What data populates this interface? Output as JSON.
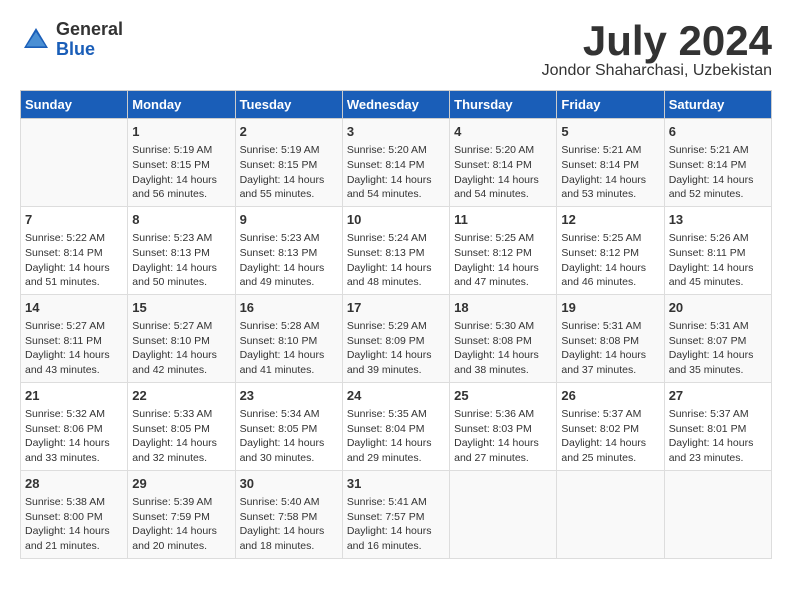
{
  "header": {
    "logo_general": "General",
    "logo_blue": "Blue",
    "month_title": "July 2024",
    "location": "Jondor Shaharchasi, Uzbekistan"
  },
  "days_of_week": [
    "Sunday",
    "Monday",
    "Tuesday",
    "Wednesday",
    "Thursday",
    "Friday",
    "Saturday"
  ],
  "weeks": [
    [
      {
        "day": "",
        "content": ""
      },
      {
        "day": "1",
        "content": "Sunrise: 5:19 AM\nSunset: 8:15 PM\nDaylight: 14 hours\nand 56 minutes."
      },
      {
        "day": "2",
        "content": "Sunrise: 5:19 AM\nSunset: 8:15 PM\nDaylight: 14 hours\nand 55 minutes."
      },
      {
        "day": "3",
        "content": "Sunrise: 5:20 AM\nSunset: 8:14 PM\nDaylight: 14 hours\nand 54 minutes."
      },
      {
        "day": "4",
        "content": "Sunrise: 5:20 AM\nSunset: 8:14 PM\nDaylight: 14 hours\nand 54 minutes."
      },
      {
        "day": "5",
        "content": "Sunrise: 5:21 AM\nSunset: 8:14 PM\nDaylight: 14 hours\nand 53 minutes."
      },
      {
        "day": "6",
        "content": "Sunrise: 5:21 AM\nSunset: 8:14 PM\nDaylight: 14 hours\nand 52 minutes."
      }
    ],
    [
      {
        "day": "7",
        "content": "Sunrise: 5:22 AM\nSunset: 8:14 PM\nDaylight: 14 hours\nand 51 minutes."
      },
      {
        "day": "8",
        "content": "Sunrise: 5:23 AM\nSunset: 8:13 PM\nDaylight: 14 hours\nand 50 minutes."
      },
      {
        "day": "9",
        "content": "Sunrise: 5:23 AM\nSunset: 8:13 PM\nDaylight: 14 hours\nand 49 minutes."
      },
      {
        "day": "10",
        "content": "Sunrise: 5:24 AM\nSunset: 8:13 PM\nDaylight: 14 hours\nand 48 minutes."
      },
      {
        "day": "11",
        "content": "Sunrise: 5:25 AM\nSunset: 8:12 PM\nDaylight: 14 hours\nand 47 minutes."
      },
      {
        "day": "12",
        "content": "Sunrise: 5:25 AM\nSunset: 8:12 PM\nDaylight: 14 hours\nand 46 minutes."
      },
      {
        "day": "13",
        "content": "Sunrise: 5:26 AM\nSunset: 8:11 PM\nDaylight: 14 hours\nand 45 minutes."
      }
    ],
    [
      {
        "day": "14",
        "content": "Sunrise: 5:27 AM\nSunset: 8:11 PM\nDaylight: 14 hours\nand 43 minutes."
      },
      {
        "day": "15",
        "content": "Sunrise: 5:27 AM\nSunset: 8:10 PM\nDaylight: 14 hours\nand 42 minutes."
      },
      {
        "day": "16",
        "content": "Sunrise: 5:28 AM\nSunset: 8:10 PM\nDaylight: 14 hours\nand 41 minutes."
      },
      {
        "day": "17",
        "content": "Sunrise: 5:29 AM\nSunset: 8:09 PM\nDaylight: 14 hours\nand 39 minutes."
      },
      {
        "day": "18",
        "content": "Sunrise: 5:30 AM\nSunset: 8:08 PM\nDaylight: 14 hours\nand 38 minutes."
      },
      {
        "day": "19",
        "content": "Sunrise: 5:31 AM\nSunset: 8:08 PM\nDaylight: 14 hours\nand 37 minutes."
      },
      {
        "day": "20",
        "content": "Sunrise: 5:31 AM\nSunset: 8:07 PM\nDaylight: 14 hours\nand 35 minutes."
      }
    ],
    [
      {
        "day": "21",
        "content": "Sunrise: 5:32 AM\nSunset: 8:06 PM\nDaylight: 14 hours\nand 33 minutes."
      },
      {
        "day": "22",
        "content": "Sunrise: 5:33 AM\nSunset: 8:05 PM\nDaylight: 14 hours\nand 32 minutes."
      },
      {
        "day": "23",
        "content": "Sunrise: 5:34 AM\nSunset: 8:05 PM\nDaylight: 14 hours\nand 30 minutes."
      },
      {
        "day": "24",
        "content": "Sunrise: 5:35 AM\nSunset: 8:04 PM\nDaylight: 14 hours\nand 29 minutes."
      },
      {
        "day": "25",
        "content": "Sunrise: 5:36 AM\nSunset: 8:03 PM\nDaylight: 14 hours\nand 27 minutes."
      },
      {
        "day": "26",
        "content": "Sunrise: 5:37 AM\nSunset: 8:02 PM\nDaylight: 14 hours\nand 25 minutes."
      },
      {
        "day": "27",
        "content": "Sunrise: 5:37 AM\nSunset: 8:01 PM\nDaylight: 14 hours\nand 23 minutes."
      }
    ],
    [
      {
        "day": "28",
        "content": "Sunrise: 5:38 AM\nSunset: 8:00 PM\nDaylight: 14 hours\nand 21 minutes."
      },
      {
        "day": "29",
        "content": "Sunrise: 5:39 AM\nSunset: 7:59 PM\nDaylight: 14 hours\nand 20 minutes."
      },
      {
        "day": "30",
        "content": "Sunrise: 5:40 AM\nSunset: 7:58 PM\nDaylight: 14 hours\nand 18 minutes."
      },
      {
        "day": "31",
        "content": "Sunrise: 5:41 AM\nSunset: 7:57 PM\nDaylight: 14 hours\nand 16 minutes."
      },
      {
        "day": "",
        "content": ""
      },
      {
        "day": "",
        "content": ""
      },
      {
        "day": "",
        "content": ""
      }
    ]
  ]
}
